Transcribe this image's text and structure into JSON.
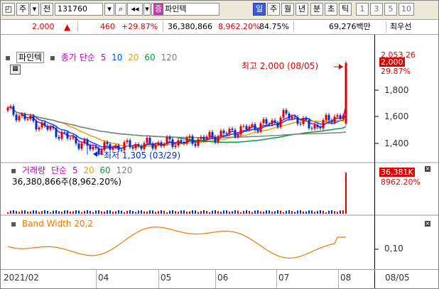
{
  "toolbar": {
    "order_btn": "주",
    "chart_btn": "전",
    "code": "131760",
    "stock_tag": "증",
    "stock_name": "파인텍",
    "periods": [
      "일",
      "주",
      "월",
      "년",
      "분",
      "초",
      "틱"
    ],
    "numbers": [
      "1",
      "3",
      "5",
      "10"
    ]
  },
  "quote": {
    "price": "2,000",
    "change": "460",
    "change_pct": "+29.87%",
    "volume": "36,380,866",
    "volume_pct": "8,962.20%",
    "ratio": "84.75%",
    "amount": "69,276백만",
    "extra": "최우선"
  },
  "price_panel": {
    "legend_name": "파인텍",
    "legend_ma": "종가 단순",
    "ma_periods": [
      "5",
      "10",
      "20",
      "60",
      "120"
    ],
    "high_annotation": "최고 2,000 (08/05)",
    "low_annotation": "최저 1,305 (03/29)",
    "y_ticks": [
      "1,800",
      "1,600",
      "1,400"
    ],
    "label_top": "2,053.26",
    "label_price": "2,000",
    "label_pct": "29.87%"
  },
  "volume_panel": {
    "legend": "거래량",
    "legend_ma": "단순",
    "ma_periods": [
      "5",
      "20",
      "60",
      "120"
    ],
    "value_text": "36,380,866주(8,962.20%)",
    "label_vol": "36,381K",
    "label_pct": "8962.20%"
  },
  "bw_panel": {
    "legend": "Band Width 20,2",
    "y_tick": "0,10"
  },
  "x_axis": {
    "labels": [
      "2021/02",
      "04",
      "05",
      "06",
      "07",
      "08"
    ],
    "right_label": "08/05"
  },
  "colors": {
    "up": "#e00000",
    "down": "#0030c0",
    "ma5": "#c000c0",
    "ma10": "#0050ff",
    "ma20": "#f0a000",
    "ma60": "#00a040",
    "ma120": "#808080",
    "bw": "#f07800"
  }
}
